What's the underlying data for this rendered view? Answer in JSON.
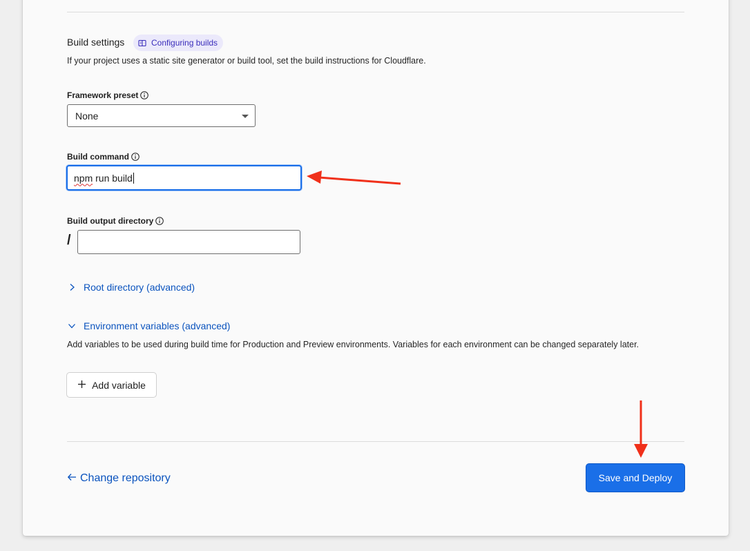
{
  "build_settings": {
    "title": "Build settings",
    "docs_link_label": "Configuring builds",
    "description": "If your project uses a static site generator or build tool, set the build instructions for Cloudflare."
  },
  "framework_preset": {
    "label": "Framework preset",
    "selected": "None"
  },
  "build_command": {
    "label": "Build command",
    "value_word1": "npm",
    "value_rest": " run build"
  },
  "build_output": {
    "label": "Build output directory",
    "prefix": "/",
    "value": ""
  },
  "root_directory": {
    "label": "Root directory (advanced)",
    "expanded": false
  },
  "env_vars": {
    "label": "Environment variables (advanced)",
    "expanded": true,
    "description": "Add variables to be used during build time for Production and Preview environments. Variables for each environment can be changed separately later.",
    "add_button_label": "Add variable"
  },
  "footer": {
    "change_repo_label": "Change repository",
    "deploy_label": "Save and Deploy"
  },
  "colors": {
    "primary": "#1a6fe8",
    "link": "#0a53be",
    "annotation_arrow": "#f0301a",
    "pill_bg": "#ebe9fb"
  },
  "icons": {
    "docs": "book-icon",
    "info": "info-icon",
    "chevron_right": "chevron-right-icon",
    "chevron_down": "chevron-down-icon",
    "plus": "plus-icon",
    "back": "arrow-left-icon"
  }
}
